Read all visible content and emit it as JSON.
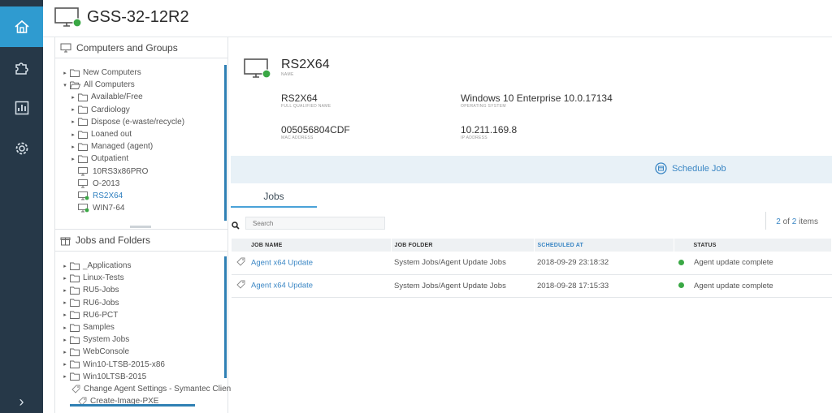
{
  "header": {
    "title": "GSS-32-12R2"
  },
  "nav": {
    "icons": [
      "home-icon",
      "puzzle-icon",
      "chart-icon",
      "gear-icon"
    ],
    "expand": "›"
  },
  "computers_panel": {
    "title": "Computers and Groups",
    "items": [
      {
        "label": "New Computers",
        "type": "folder",
        "arrow": "▸"
      },
      {
        "label": "All Computers",
        "type": "folder-open",
        "arrow": "▾"
      },
      {
        "label": "Available/Free",
        "type": "folder",
        "arrow": "▸"
      },
      {
        "label": "Cardiology",
        "type": "folder",
        "arrow": "▸"
      },
      {
        "label": "Dispose (e-waste/recycle)",
        "type": "folder",
        "arrow": "▸"
      },
      {
        "label": "Loaned out",
        "type": "folder",
        "arrow": "▸"
      },
      {
        "label": "Managed (agent)",
        "type": "folder",
        "arrow": "▸"
      },
      {
        "label": "Outpatient",
        "type": "folder",
        "arrow": "▸"
      },
      {
        "label": "10RS3x86PRO",
        "type": "computer"
      },
      {
        "label": "O-2013",
        "type": "computer"
      },
      {
        "label": "RS2X64",
        "type": "computer-online",
        "selected": true
      },
      {
        "label": "WIN7-64",
        "type": "computer-online"
      }
    ]
  },
  "jobs_panel": {
    "title": "Jobs and Folders",
    "items": [
      {
        "label": "_Applications",
        "type": "folder",
        "arrow": "▸"
      },
      {
        "label": "Linux-Tests",
        "type": "folder",
        "arrow": "▸"
      },
      {
        "label": "RU5-Jobs",
        "type": "folder",
        "arrow": "▸"
      },
      {
        "label": "RU6-Jobs",
        "type": "folder",
        "arrow": "▸"
      },
      {
        "label": "RU6-PCT",
        "type": "folder",
        "arrow": "▸"
      },
      {
        "label": "Samples",
        "type": "folder",
        "arrow": "▸"
      },
      {
        "label": "System Jobs",
        "type": "folder",
        "arrow": "▸"
      },
      {
        "label": "WebConsole",
        "type": "folder",
        "arrow": "▸"
      },
      {
        "label": "Win10-LTSB-2015-x86",
        "type": "folder",
        "arrow": "▸"
      },
      {
        "label": "Win10LTSB-2015",
        "type": "folder",
        "arrow": "▸"
      },
      {
        "label": "Change Agent Settings - Symantec Clien",
        "type": "job"
      },
      {
        "label": "Create-Image-PXE",
        "type": "job"
      }
    ]
  },
  "device": {
    "name": "RS2X64",
    "name_caption": "NAME",
    "fqn": "RS2X64",
    "fqn_caption": "FULL QUALIFIED NAME",
    "os": "Windows 10 Enterprise 10.0.17134",
    "os_caption": "OPERATING SYSTEM",
    "mac": "005056804CDF",
    "mac_caption": "MAC ADDRESS",
    "ip": "10.211.169.8",
    "ip_caption": "IP ADDRESS"
  },
  "actions": {
    "schedule_job": "Schedule Job"
  },
  "tabs": {
    "jobs": "Jobs"
  },
  "search": {
    "placeholder": "Search"
  },
  "pager": {
    "current": "2",
    "of": "of",
    "total": "2",
    "suffix": "items"
  },
  "table": {
    "columns": [
      "JOB NAME",
      "JOB FOLDER",
      "SCHEDULED AT",
      "STATUS"
    ],
    "rows": [
      {
        "name": "Agent x64 Update",
        "folder": "System Jobs/Agent Update Jobs",
        "scheduled": "2018-09-29 23:18:32",
        "status": "Agent update complete"
      },
      {
        "name": "Agent x64 Update",
        "folder": "System Jobs/Agent Update Jobs",
        "scheduled": "2018-09-28 17:15:33",
        "status": "Agent update complete"
      }
    ]
  },
  "colors": {
    "rail": "#263848",
    "active": "#2f9bd0",
    "accent": "#3a86c4",
    "online": "#3aa845"
  }
}
